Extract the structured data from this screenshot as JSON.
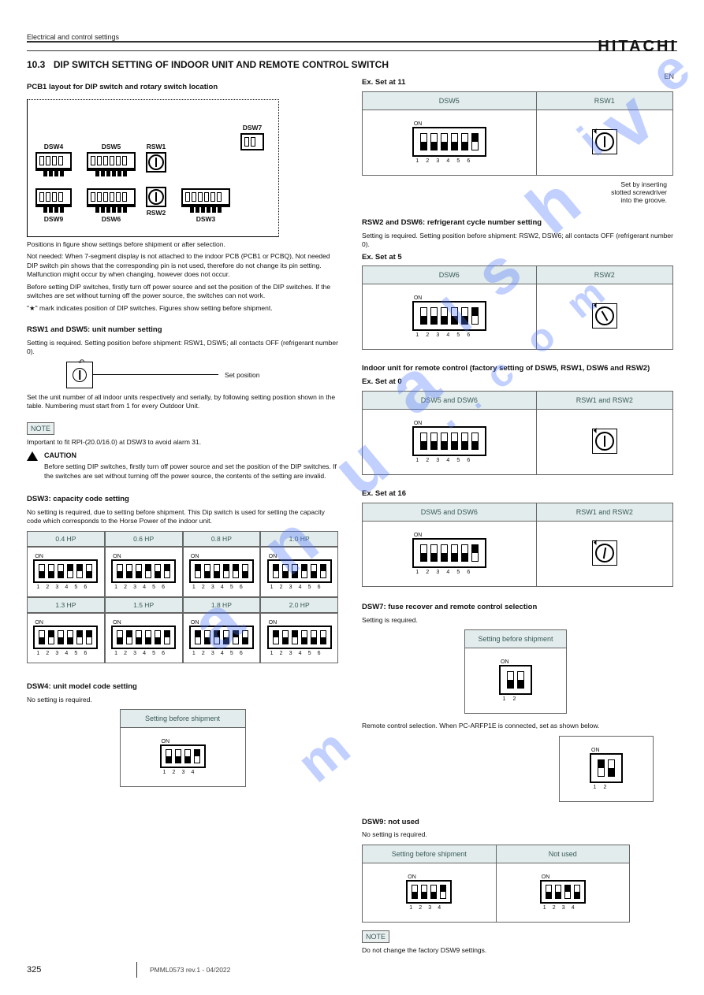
{
  "header": {
    "logo": "HITACHI",
    "pretitle": "Electrical and control settings"
  },
  "section": {
    "num": "10.3",
    "title": "DIP SWITCH SETTING OF INDOOR UNIT AND REMOTE CONTROL SWITCH"
  },
  "pcb": {
    "title": "PCB1 layout for DIP switch and rotary switch location",
    "labels": {
      "dsw4": "DSW4",
      "dsw5": "DSW5",
      "rsw1": "RSW1",
      "dsw7": "DSW7",
      "dsw9": "DSW9",
      "dsw6": "DSW6",
      "rsw2": "RSW2",
      "dsw3": "DSW3"
    }
  },
  "intro": {
    "p1": "Positions in figure show settings before shipment or after selection.",
    "p2": "Not needed: When 7-segment display is not attached to the indoor PCB (PCB1 or PCBQ), Not needed DIP switch pin shows that the corresponding pin is not used, therefore do not change its pin setting. Malfunction might occur by when changing, however does not occur.",
    "p3": "Before setting DIP switches, firstly turn off power source and set the position of the DIP switches. If the switches are set without turning off the power source, the switches can not work.",
    "star": "\"★\" mark indicates position of DIP switches. Figures show setting before shipment.",
    "note_hd": "NOTE",
    "note": "Important to fit RPI-(20.0/16.0) at DSW3 to avoid alarm 31.",
    "caution_hd": "CAUTION",
    "caution": "Before setting DIP switches, firstly turn off power source and set the position of the DIP switches. If the switches are set without turning off the power source, the contents of the setting are invalid."
  },
  "rsw": {
    "hd": "RSW1 and DSW5: unit number setting",
    "p1": "Setting is required. Setting position before shipment: RSW1, DSW5; all contacts OFF (refrigerant number 0).",
    "p2": "Set the unit number of all indoor units respectively and serially, by following setting position shown in the table. Numbering must start from 1 for every Outdoor Unit.",
    "setpos": "Set position"
  },
  "dsw3": {
    "hd": "DSW3: capacity code setting",
    "p": "No setting is required, due to setting before shipment. This Dip switch is used for setting the capacity code which corresponds to the Horse Power of the indoor unit.",
    "cols": [
      "0.4 HP",
      "0.6 HP",
      "0.8 HP",
      "1.0 HP",
      "1.3 HP",
      "1.5 HP",
      "1.8 HP",
      "2.0 HP"
    ],
    "patterns": [
      [
        0,
        0,
        0,
        1,
        1,
        0
      ],
      [
        0,
        0,
        0,
        1,
        0,
        1
      ],
      [
        1,
        0,
        0,
        1,
        1,
        0
      ],
      [
        1,
        0,
        0,
        1,
        0,
        1
      ],
      [
        0,
        1,
        0,
        0,
        1,
        1
      ],
      [
        0,
        1,
        0,
        0,
        0,
        1
      ],
      [
        1,
        0,
        1,
        0,
        1,
        0
      ],
      [
        1,
        0,
        1,
        0,
        0,
        0
      ]
    ]
  },
  "dsw4": {
    "hd": "DSW4: unit model code setting",
    "p": "No setting is required.",
    "th": "Setting before shipment",
    "pat": [
      0,
      0,
      0,
      1
    ]
  },
  "ex11": {
    "hd": "Ex. Set at 11",
    "th1": "DSW5",
    "th2": "RSW1",
    "pat": [
      0,
      0,
      0,
      0,
      0,
      1
    ],
    "sub": "Set by inserting\nslotted screwdriver\ninto the groove."
  },
  "rsw2": {
    "hd": "RSW2 and DSW6: refrigerant cycle number setting",
    "p": "Setting is required. Setting position before shipment: RSW2, DSW6; all contacts OFF (refrigerant number 0).",
    "ex": "Ex. Set at 5",
    "th1": "DSW6",
    "th2": "RSW2",
    "pat": [
      0,
      0,
      0,
      0,
      0,
      1
    ]
  },
  "remote": {
    "hd": "Indoor unit for remote control (factory setting of DSW5, RSW1, DSW6 and RSW2)",
    "ex": "Ex. Set at 0",
    "th1": "DSW5 and DSW6",
    "th2": "RSW1 and RSW2",
    "pat": [
      0,
      0,
      0,
      0,
      0,
      0
    ]
  },
  "ex16": {
    "th1": "DSW5 and DSW6",
    "th2": "RSW1 and RSW2",
    "hd": "Ex. Set at 16",
    "pat": [
      0,
      0,
      0,
      0,
      0,
      1
    ]
  },
  "dsw7": {
    "hd": "DSW7: fuse recover and remote control selection",
    "p": "Setting is required.",
    "th": "Setting before shipment",
    "pat": [
      0,
      0
    ],
    "p2": "Remote control selection. When PC-ARFP1E is connected, set as shown below.",
    "pat2": [
      1,
      0
    ]
  },
  "dsw9": {
    "hd": "DSW9: not used",
    "p": "No setting is required.",
    "th1": "Setting before shipment",
    "th2": "Not used",
    "note_hd": "NOTE",
    "note": "Do not change the factory DSW9 settings.",
    "pat1": [
      0,
      0,
      0,
      1
    ],
    "pat2": [
      0,
      0,
      1,
      0
    ]
  },
  "footer": {
    "page": "325",
    "doc": "PMML0573 rev.1 - 04/2022",
    "lang": "EN"
  }
}
